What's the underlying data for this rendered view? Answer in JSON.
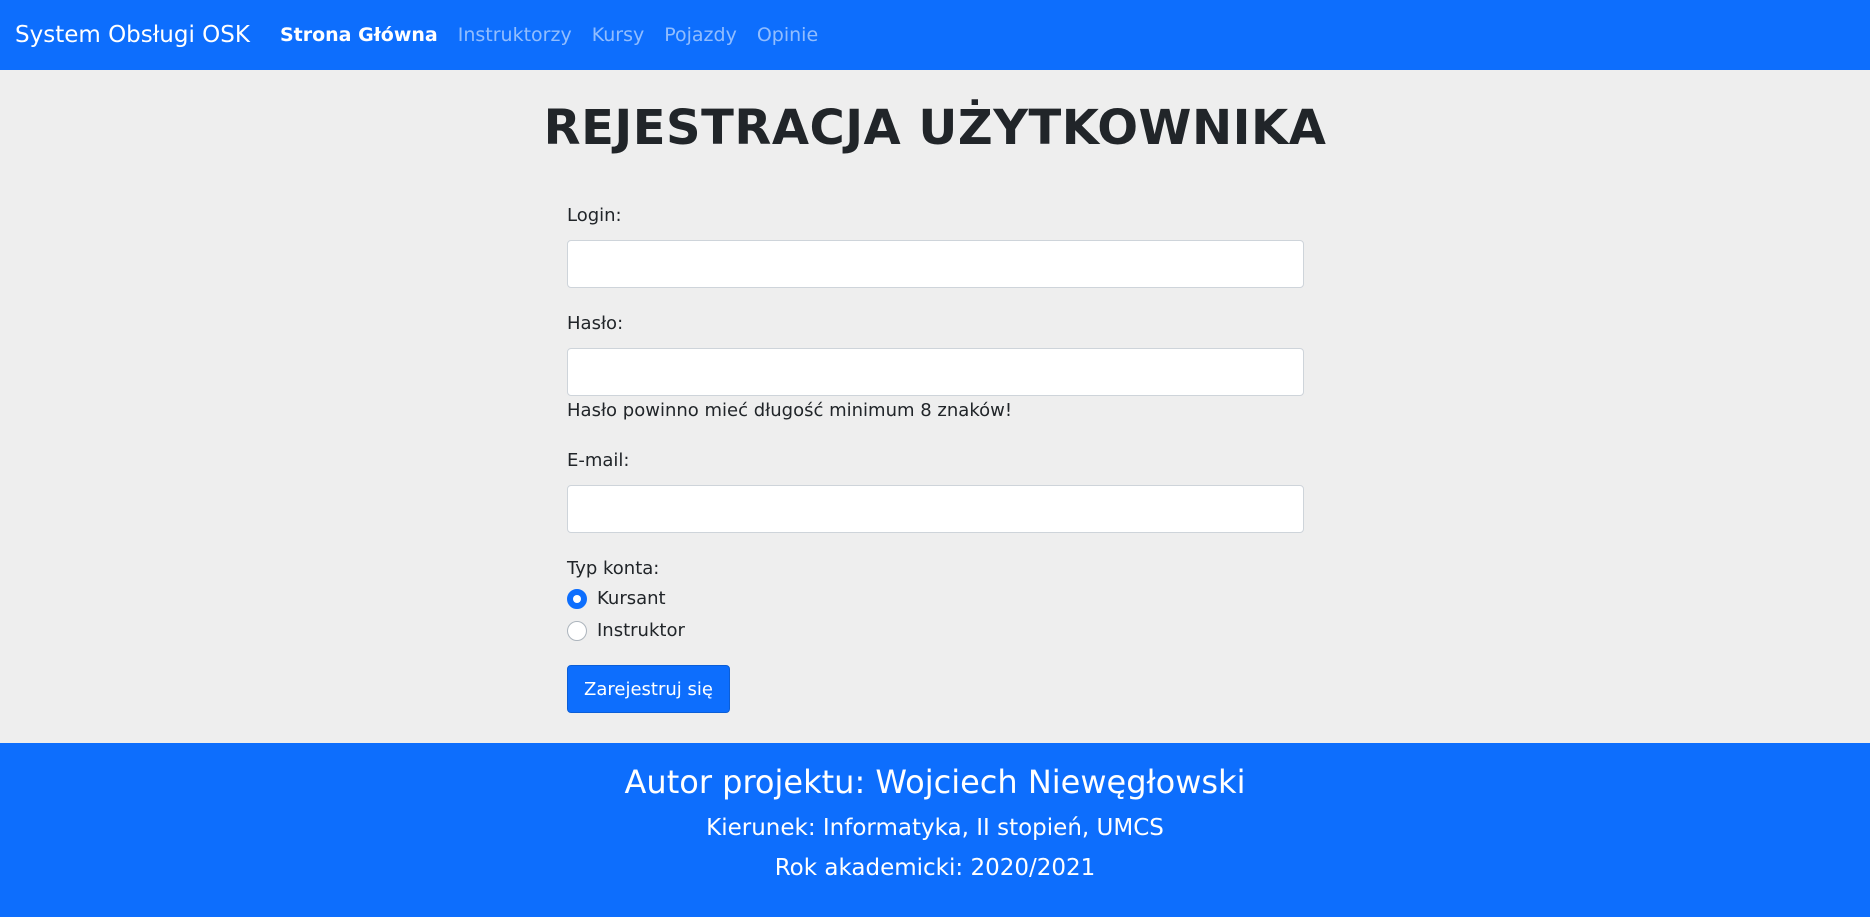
{
  "navbar": {
    "brand": "System Obsługi OSK",
    "links": [
      {
        "label": "Strona Główna",
        "active": true
      },
      {
        "label": "Instruktorzy",
        "active": false
      },
      {
        "label": "Kursy",
        "active": false
      },
      {
        "label": "Pojazdy",
        "active": false
      },
      {
        "label": "Opinie",
        "active": false
      }
    ]
  },
  "main": {
    "title": "REJESTRACJA UŻYTKOWNIKA",
    "form": {
      "login_label": "Login:",
      "login_value": "",
      "password_label": "Hasło:",
      "password_value": "",
      "password_help": "Hasło powinno mieć długość minimum 8 znaków!",
      "email_label": "E-mail:",
      "email_value": "",
      "account_type_label": "Typ konta:",
      "account_types": [
        {
          "label": "Kursant",
          "checked": true
        },
        {
          "label": "Instruktor",
          "checked": false
        }
      ],
      "submit_label": "Zarejestruj się"
    }
  },
  "footer": {
    "author": "Autor projektu: Wojciech Niewęgłowski",
    "course": "Kierunek: Informatyka, II stopień, UMCS",
    "year": "Rok akademicki: 2020/2021"
  },
  "colors": {
    "primary": "#0d6efd",
    "background": "#eeeeee"
  }
}
